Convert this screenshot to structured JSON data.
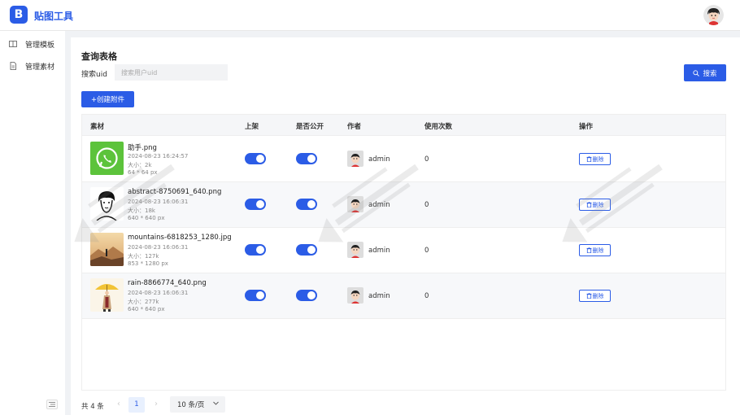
{
  "app": {
    "logo_letter": "B",
    "title": "贴图工具"
  },
  "sidebar": {
    "items": [
      {
        "label": "管理模板",
        "icon": "book-icon"
      },
      {
        "label": "管理素材",
        "icon": "file-icon"
      }
    ]
  },
  "main": {
    "title": "查询表格",
    "search": {
      "label": "搜索uid",
      "placeholder": "搜索用户uid",
      "button": "搜索"
    },
    "create_button": "+创建附件"
  },
  "table": {
    "columns": [
      "素材",
      "上架",
      "是否公开",
      "作者",
      "使用次数",
      "操作"
    ],
    "rows": [
      {
        "name": "助手.png",
        "date": "2024-08-23 16:24:57",
        "size": "大小：2k",
        "dims": "64 * 64 px",
        "listed": true,
        "public": true,
        "author": "admin",
        "uses": "0",
        "action": "删除"
      },
      {
        "name": "abstract-8750691_640.png",
        "date": "2024-08-23 16:06:31",
        "size": "大小：18k",
        "dims": "640 * 640 px",
        "listed": true,
        "public": true,
        "author": "admin",
        "uses": "0",
        "action": "删除"
      },
      {
        "name": "mountains-6818253_1280.jpg",
        "date": "2024-08-23 16:06:31",
        "size": "大小：127k",
        "dims": "853 * 1280 px",
        "listed": true,
        "public": true,
        "author": "admin",
        "uses": "0",
        "action": "删除"
      },
      {
        "name": "rain-8866774_640.png",
        "date": "2024-08-23 16:06:31",
        "size": "大小：277k",
        "dims": "640 * 640 px",
        "listed": true,
        "public": true,
        "author": "admin",
        "uses": "0",
        "action": "删除"
      }
    ]
  },
  "pagination": {
    "total": "共 4 条",
    "prev": "‹",
    "current": "1",
    "next": "›",
    "page_size": "10 条/页"
  },
  "colors": {
    "primary": "#2b5ce6"
  }
}
